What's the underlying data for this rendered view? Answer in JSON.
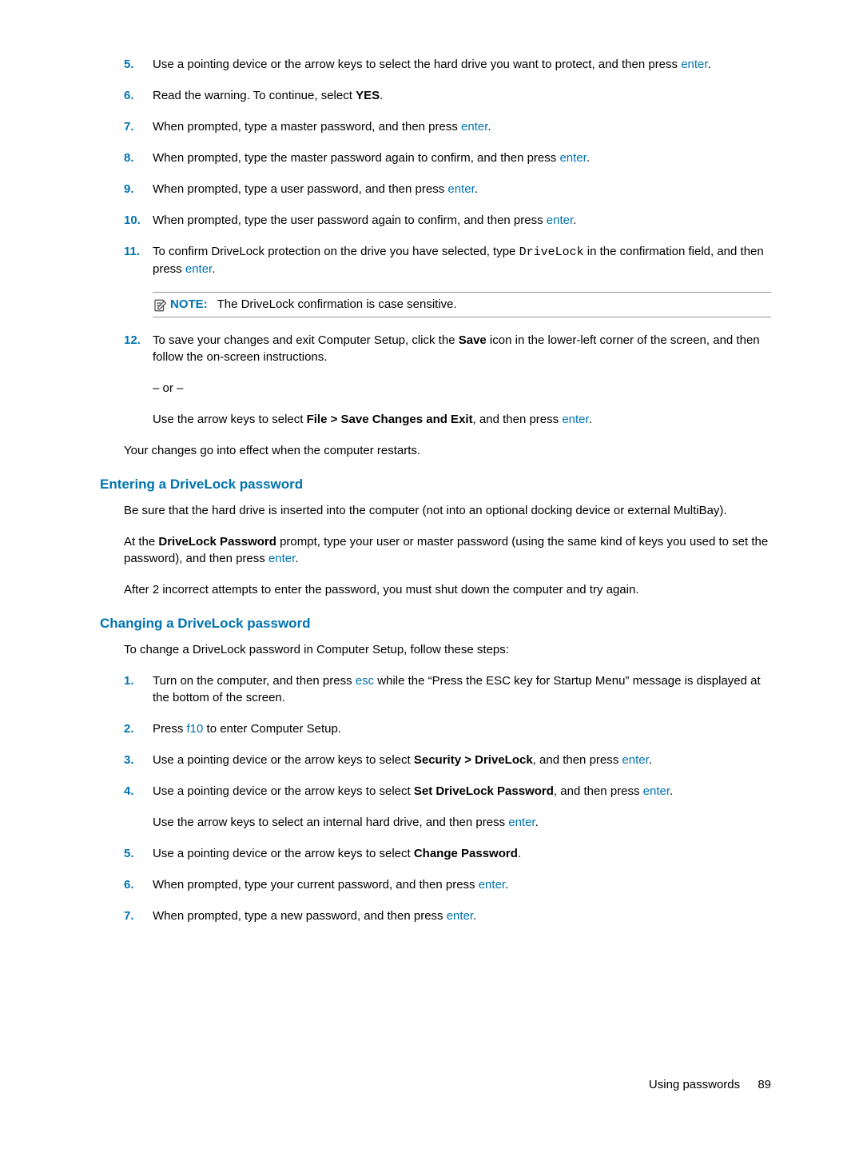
{
  "steps_top": [
    {
      "num": "5.",
      "parts": [
        "Use a pointing device or the arrow keys to select the hard drive you want to protect, and then press ",
        {
          "blue": "enter"
        },
        "."
      ]
    },
    {
      "num": "6.",
      "parts": [
        "Read the warning. To continue, select ",
        {
          "bold": "YES"
        },
        "."
      ]
    },
    {
      "num": "7.",
      "parts": [
        "When prompted, type a master password, and then press ",
        {
          "blue": "enter"
        },
        "."
      ]
    },
    {
      "num": "8.",
      "parts": [
        "When prompted, type the master password again to confirm, and then press ",
        {
          "blue": "enter"
        },
        "."
      ]
    },
    {
      "num": "9.",
      "parts": [
        "When prompted, type a user password, and then press ",
        {
          "blue": "enter"
        },
        "."
      ]
    },
    {
      "num": "10.",
      "parts": [
        "When prompted, type the user password again to confirm, and then press ",
        {
          "blue": "enter"
        },
        "."
      ]
    },
    {
      "num": "11.",
      "parts": [
        "To confirm DriveLock protection on the drive you have selected, type ",
        {
          "mono": "DriveLock"
        },
        " in the confirmation field, and then press ",
        {
          "blue": "enter"
        },
        "."
      ]
    }
  ],
  "note": {
    "label": "NOTE:",
    "text": "The DriveLock confirmation is case sensitive."
  },
  "step12": {
    "num": "12.",
    "parts": [
      "To save your changes and exit Computer Setup, click the ",
      {
        "bold": "Save"
      },
      " icon in the lower-left corner of the screen, and then follow the on-screen instructions."
    ]
  },
  "or_text": "– or –",
  "step12_alt": [
    "Use the arrow keys to select ",
    {
      "bold": "File > Save Changes and Exit"
    },
    ", and then press ",
    {
      "blue": "enter"
    },
    "."
  ],
  "restart": "Your changes go into effect when the computer restarts.",
  "section_enter": {
    "title": "Entering a DriveLock password",
    "p1": "Be sure that the hard drive is inserted into the computer (not into an optional docking device or external MultiBay).",
    "p2": [
      "At the ",
      {
        "bold": "DriveLock Password"
      },
      " prompt, type your user or master password (using the same kind of keys you used to set the password), and then press ",
      {
        "blue": "enter"
      },
      "."
    ],
    "p3": "After 2 incorrect attempts to enter the password, you must shut down the computer and try again."
  },
  "section_change": {
    "title": "Changing a DriveLock password",
    "intro": "To change a DriveLock password in Computer Setup, follow these steps:",
    "steps": [
      {
        "num": "1.",
        "parts": [
          "Turn on the computer, and then press ",
          {
            "blue": "esc"
          },
          " while the “Press the ESC key for Startup Menu” message is displayed at the bottom of the screen."
        ]
      },
      {
        "num": "2.",
        "parts": [
          "Press ",
          {
            "blue": "f10"
          },
          " to enter Computer Setup."
        ]
      },
      {
        "num": "3.",
        "parts": [
          "Use a pointing device or the arrow keys to select ",
          {
            "bold": "Security > DriveLock"
          },
          ", and then press ",
          {
            "blue": "enter"
          },
          "."
        ]
      },
      {
        "num": "4.",
        "parts": [
          "Use a pointing device or the arrow keys to select ",
          {
            "bold": "Set DriveLock Password"
          },
          ", and then press ",
          {
            "blue": "enter"
          },
          "."
        ],
        "sub": [
          "Use the arrow keys to select an internal hard drive, and then press ",
          {
            "blue": "enter"
          },
          "."
        ]
      },
      {
        "num": "5.",
        "parts": [
          "Use a pointing device or the arrow keys to select ",
          {
            "bold": "Change Password"
          },
          "."
        ]
      },
      {
        "num": "6.",
        "parts": [
          "When prompted, type your current password, and then press ",
          {
            "blue": "enter"
          },
          "."
        ]
      },
      {
        "num": "7.",
        "parts": [
          "When prompted, type a new password, and then press ",
          {
            "blue": "enter"
          },
          "."
        ]
      }
    ]
  },
  "footer": {
    "text": "Using passwords",
    "page": "89"
  }
}
